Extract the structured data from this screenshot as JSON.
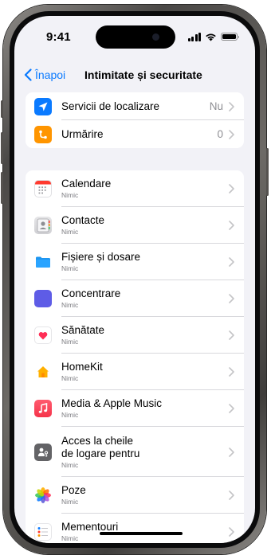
{
  "status_bar": {
    "time": "9:41"
  },
  "nav": {
    "back_label": "Înapoi",
    "title": "Intimitate și securitate"
  },
  "group1": [
    {
      "label": "Servicii de localizare",
      "value": "Nu",
      "icon": "location-arrow-icon",
      "color": "#0a7aff"
    },
    {
      "label": "Urmărire",
      "value": "0",
      "icon": "tracking-icon",
      "color": "#ff9500"
    }
  ],
  "apps": [
    {
      "label": "Calendare",
      "sub": "Nimic",
      "icon": "calendar-icon"
    },
    {
      "label": "Contacte",
      "sub": "Nimic",
      "icon": "contacts-icon"
    },
    {
      "label": "Fișiere și dosare",
      "sub": "Nimic",
      "icon": "folder-icon"
    },
    {
      "label": "Concentrare",
      "sub": "Nimic",
      "icon": "moon-icon"
    },
    {
      "label": "Sănătate",
      "sub": "Nimic",
      "icon": "heart-icon"
    },
    {
      "label": "HomeKit",
      "sub": "Nimic",
      "icon": "home-icon"
    },
    {
      "label": "Media & Apple Music",
      "sub": "Nimic",
      "icon": "music-note-icon"
    },
    {
      "label": "Acces la cheile",
      "label2": "de logare pentru",
      "sub": "Nimic",
      "icon": "passkey-access-icon"
    },
    {
      "label": "Poze",
      "sub": "Nimic",
      "icon": "photos-icon"
    },
    {
      "label": "Mementouri",
      "sub": "Nimic",
      "icon": "reminders-icon"
    }
  ],
  "colors": {
    "accent": "#0a7aff",
    "background": "#f2f2f7"
  }
}
